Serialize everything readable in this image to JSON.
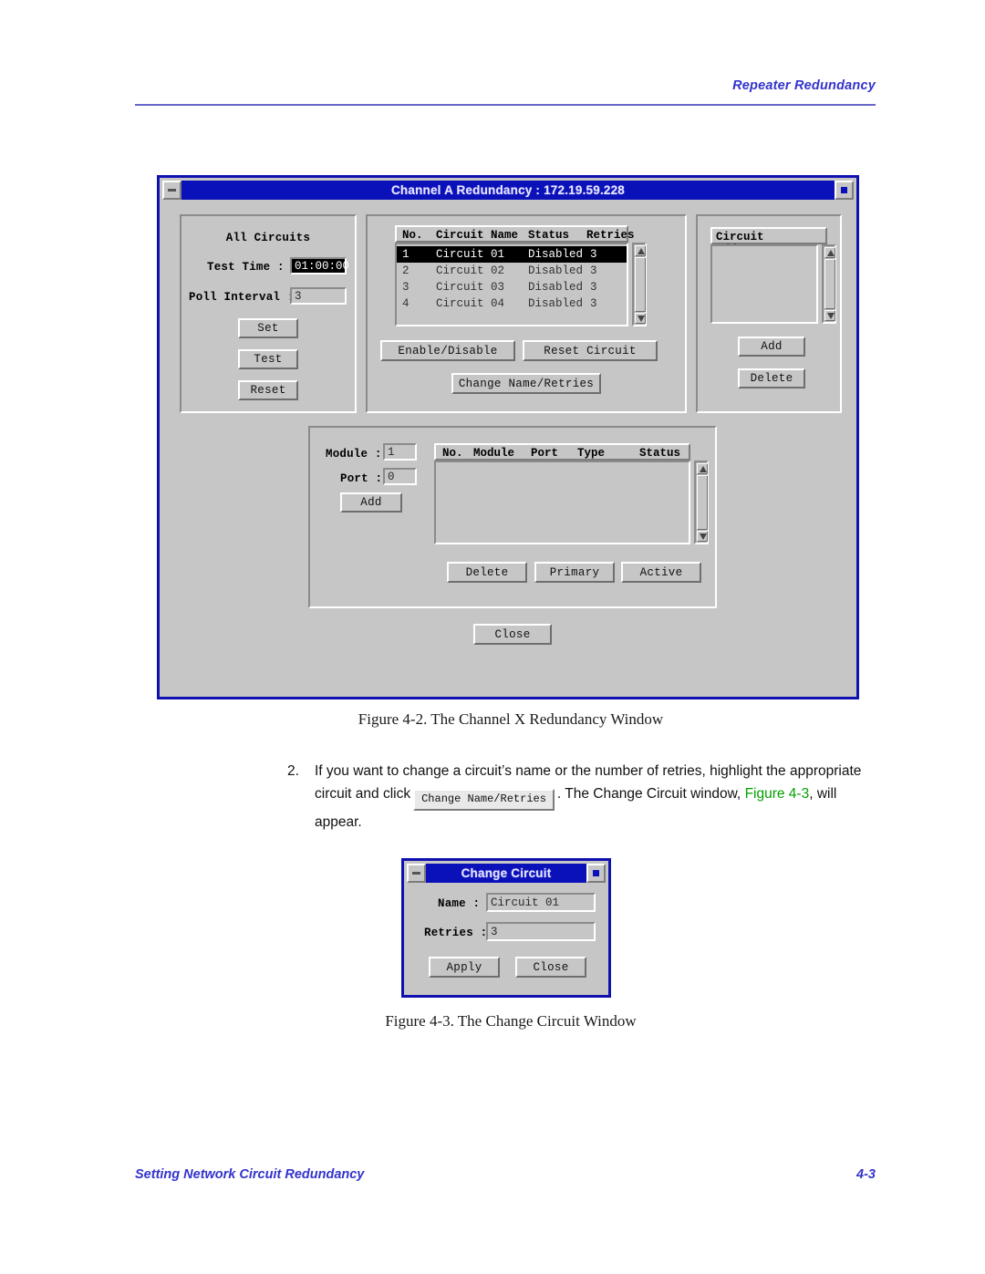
{
  "page": {
    "header_title": "Repeater Redundancy",
    "footer_title": "Setting Network Circuit Redundancy",
    "footer_page": "4-3"
  },
  "main_window": {
    "title": "Channel A Redundancy : 172.19.59.228",
    "minimize_icon": "minimize-icon",
    "maximize_icon": "maximize-icon",
    "all_circuits": {
      "group_title": "All Circuits",
      "test_time_label": "Test Time :",
      "test_time_value": "01:00:00",
      "poll_interval_label": "Poll Interval :",
      "poll_interval_value": "3",
      "set_button": "Set",
      "test_button": "Test",
      "reset_button": "Reset"
    },
    "circuits": {
      "columns": [
        "No.",
        "Circuit Name",
        "Status",
        "Retries"
      ],
      "rows": [
        {
          "no": "1",
          "name": "Circuit 01",
          "status": "Disabled",
          "retries": "3",
          "selected": true
        },
        {
          "no": "2",
          "name": "Circuit 02",
          "status": "Disabled",
          "retries": "3",
          "selected": false
        },
        {
          "no": "3",
          "name": "Circuit 03",
          "status": "Disabled",
          "retries": "3",
          "selected": false
        },
        {
          "no": "4",
          "name": "Circuit 04",
          "status": "Disabled",
          "retries": "3",
          "selected": false
        }
      ],
      "enable_disable_button": "Enable/Disable",
      "reset_circuit_button": "Reset Circuit",
      "change_name_retries_button": "Change Name/Retries"
    },
    "circuit_addresses": {
      "group_title": "Circuit Addresses",
      "items": [],
      "add_button": "Add",
      "delete_button": "Delete"
    },
    "ports": {
      "module_label": "Module :",
      "module_value": "1",
      "port_label": "Port :",
      "port_value": "0",
      "add_button": "Add",
      "columns": [
        "No.",
        "Module",
        "Port",
        "Type",
        "Status"
      ],
      "rows": [],
      "delete_button": "Delete",
      "primary_button": "Primary",
      "active_button": "Active"
    },
    "close_button": "Close"
  },
  "figure_2_caption": "Figure 4-2.  The Channel X Redundancy Window",
  "step": {
    "number": "2.",
    "text_part1": "If you want to change a circuit’s name or the number of retries, highlight the appropriate circuit and click",
    "inline_button": "Change Name/Retries",
    "text_part2": ". The Change Circuit window,",
    "figure_ref": "Figure 4-3",
    "text_part3": ", will appear."
  },
  "change_circuit_window": {
    "title": "Change Circuit",
    "minimize_icon": "minimize-icon",
    "maximize_icon": "maximize-icon",
    "name_label": "Name :",
    "name_value": "Circuit 01",
    "retries_label": "Retries :",
    "retries_value": "3",
    "apply_button": "Apply",
    "close_button": "Close"
  },
  "figure_3_caption": "Figure 4-3.  The Change Circuit Window",
  "colors": {
    "accent_blue": "#3333cc",
    "title_blue": "#0b11b8",
    "face_gray": "#c6c6c6",
    "green_ref": "#00a000"
  }
}
